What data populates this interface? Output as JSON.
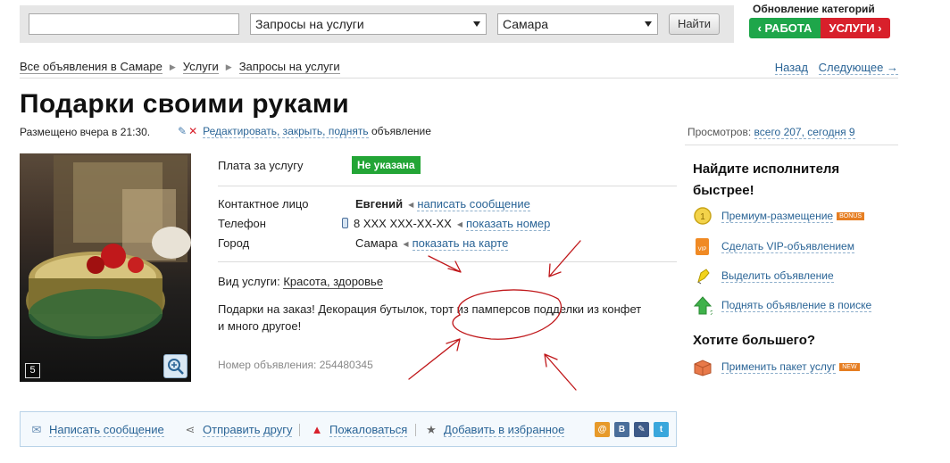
{
  "search": {
    "query_value": "",
    "category_value": "Запросы на услуги",
    "city_value": "Самара",
    "find_label": "Найти"
  },
  "promo": {
    "title": "Обновление категорий",
    "work_label": "РАБОТА",
    "services_label": "УСЛУГИ"
  },
  "breadcrumbs": [
    "Все объявления в Самаре",
    "Услуги",
    "Запросы на услуги"
  ],
  "nav": {
    "back": "Назад",
    "next": "Следующее →"
  },
  "ad": {
    "title": "Подарки своими руками",
    "posted": "Размещено вчера в 21:30.",
    "edit_links": "Редактировать, закрыть, поднять",
    "edit_suffix": "объявление",
    "photo_count": "5",
    "fee_label": "Плата за услугу",
    "fee_value": "Не указана",
    "contact_label": "Контактное лицо",
    "contact_name": "Евгений",
    "write_message": "написать сообщение",
    "phone_label": "Телефон",
    "phone_value": "8 XXX XXX-XX-XX",
    "show_number": "показать номер",
    "city_label": "Город",
    "city_value": "Самара",
    "show_map": "показать на карте",
    "service_type_label": "Вид услуги:",
    "service_type_value": "Красота, здоровье",
    "description": "Подарки на заказ! Декорация бутылок, торт из памперсов подделки из конфет и много другое!",
    "ad_number": "Номер объявления: 254480345"
  },
  "views": {
    "label": "Просмотров:",
    "value": "всего 207, сегодня 9"
  },
  "sidebar": {
    "heading1": "Найдите исполнителя быстрее!",
    "items": [
      {
        "label": "Премиум-размещение",
        "tag": "BONUS"
      },
      {
        "label": "Сделать VIP-объявлением"
      },
      {
        "label": "Выделить объявление"
      },
      {
        "label": "Поднять объявление в поиске"
      }
    ],
    "heading2": "Хотите большего?",
    "package": {
      "label": "Применить пакет услуг",
      "tag": "NEW"
    }
  },
  "actions": {
    "write": "Написать сообщение",
    "send_friend": "Отправить другу",
    "complain": "Пожаловаться",
    "favorite": "Добавить в избранное"
  },
  "social": [
    "@",
    "B",
    "✎",
    "t"
  ],
  "colors": {
    "link": "#2a6496",
    "green": "#23a536",
    "red": "#d8202b",
    "annotation": "#c0181b"
  }
}
